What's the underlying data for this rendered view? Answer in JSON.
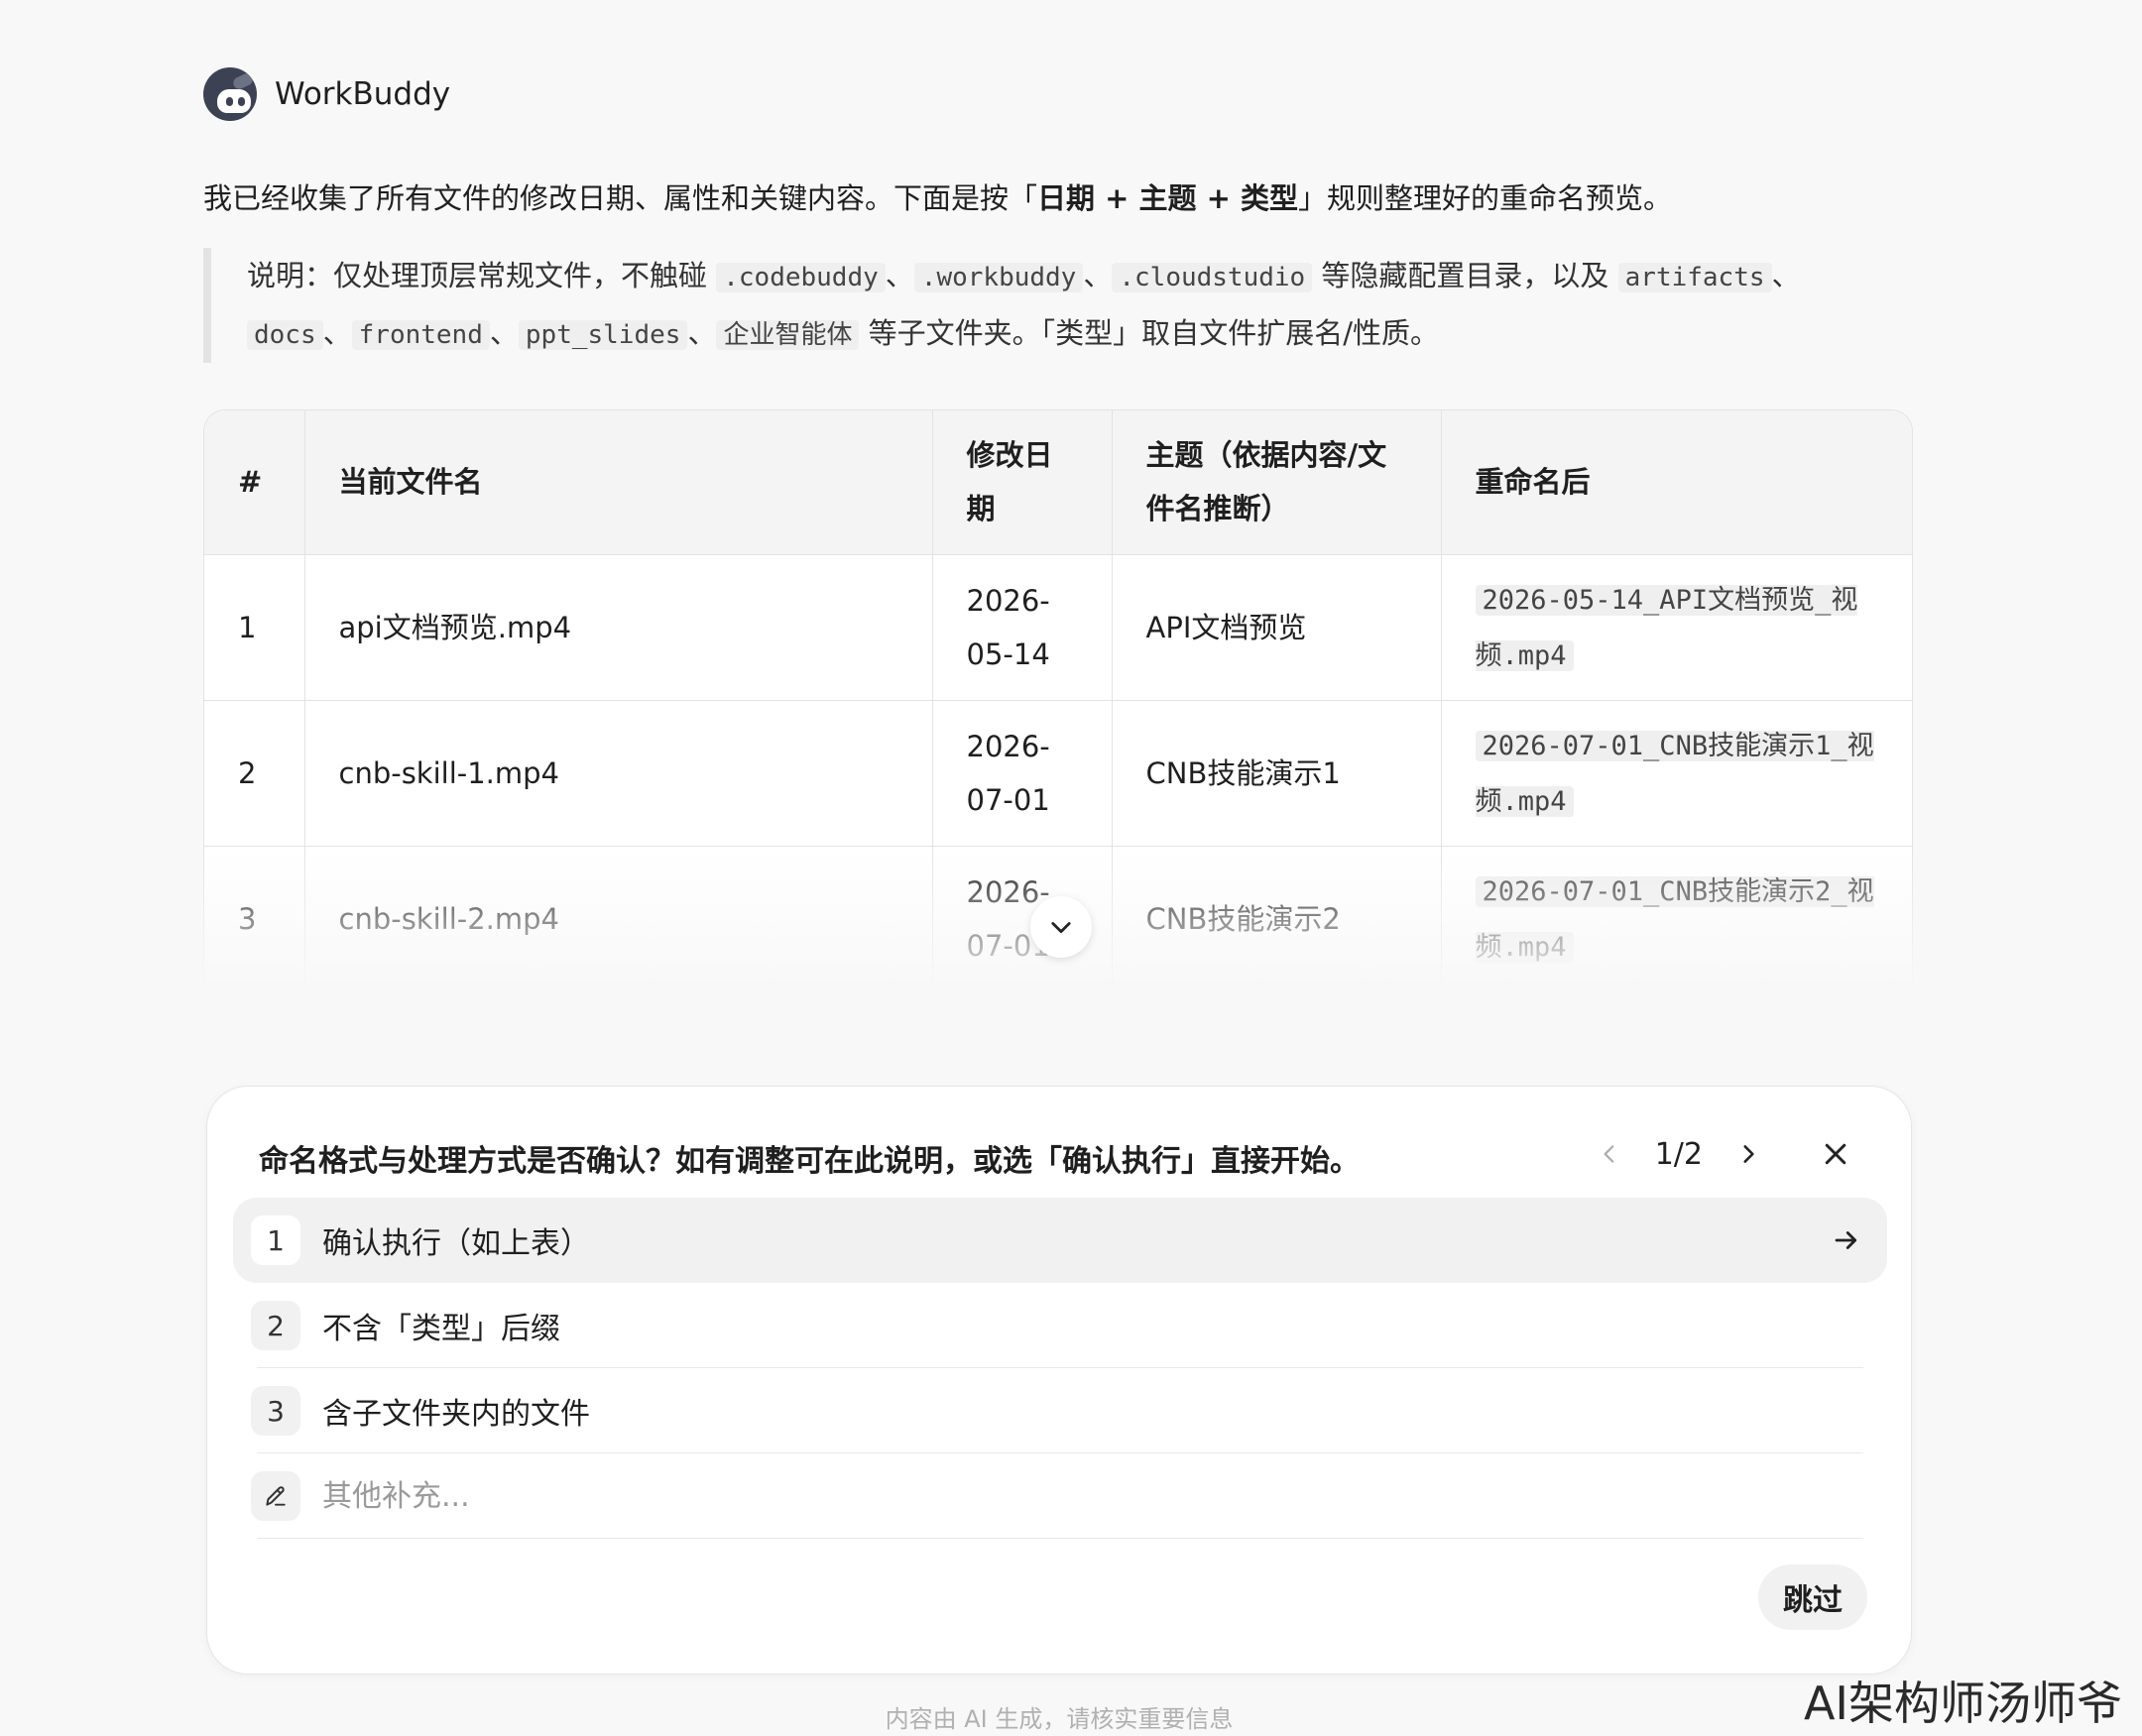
{
  "app": {
    "name": "WorkBuddy"
  },
  "message": {
    "intro_pre": "我已经收集了所有文件的修改日期、属性和关键内容。下面是按「",
    "intro_rule": "日期 + 主题 + 类型",
    "intro_post": "」规则整理好的重命名预览。",
    "note": {
      "prefix": "说明：仅处理顶层常规文件，不触碰 ",
      "hidden_dirs": [
        ".codebuddy",
        ".workbuddy",
        ".cloudstudio"
      ],
      "mid": " 等隐藏配置目录，以及 ",
      "sub_dirs": [
        "artifacts",
        "docs",
        "frontend",
        "ppt_slides",
        "企业智能体"
      ],
      "suffix": " 等子文件夹。「类型」取自文件扩展名/性质。",
      "sep": "、"
    }
  },
  "table": {
    "headers": [
      "#",
      "当前文件名",
      "修改日期",
      "主题（依据内容/文件名推断）",
      "重命名后"
    ],
    "rows": [
      {
        "num": "1",
        "filename": "api文档预览.mp4",
        "date": "2026-05-14",
        "topic": "API文档预览",
        "renamed": "2026-05-14_API文档预览_视频.mp4"
      },
      {
        "num": "2",
        "filename": "cnb-skill-1.mp4",
        "date": "2026-07-01",
        "topic": "CNB技能演示1",
        "renamed": "2026-07-01_CNB技能演示1_视频.mp4"
      },
      {
        "num": "3",
        "filename": "cnb-skill-2.mp4",
        "date": "2026-07-01",
        "topic": "CNB技能演示2",
        "renamed": "2026-07-01_CNB技能演示2_视频.mp4"
      }
    ]
  },
  "question": {
    "title": "命名格式与处理方式是否确认？如有调整可在此说明，或选「确认执行」直接开始。",
    "pager": "1/2",
    "options": [
      {
        "num": "1",
        "label": "确认执行（如上表）"
      },
      {
        "num": "2",
        "label": "不含「类型」后缀"
      },
      {
        "num": "3",
        "label": "含子文件夹内的文件"
      }
    ],
    "other_placeholder": "其他补充...",
    "skip_label": "跳过"
  },
  "footer": {
    "disclaimer": "内容由 AI 生成，请核实重要信息"
  },
  "watermark": "AI架构师汤师爷",
  "icons": [
    "workbuddy-logo-icon",
    "chevron-down-icon",
    "chevron-left-icon",
    "chevron-right-icon",
    "close-icon",
    "arrow-right-icon",
    "pencil-icon"
  ]
}
